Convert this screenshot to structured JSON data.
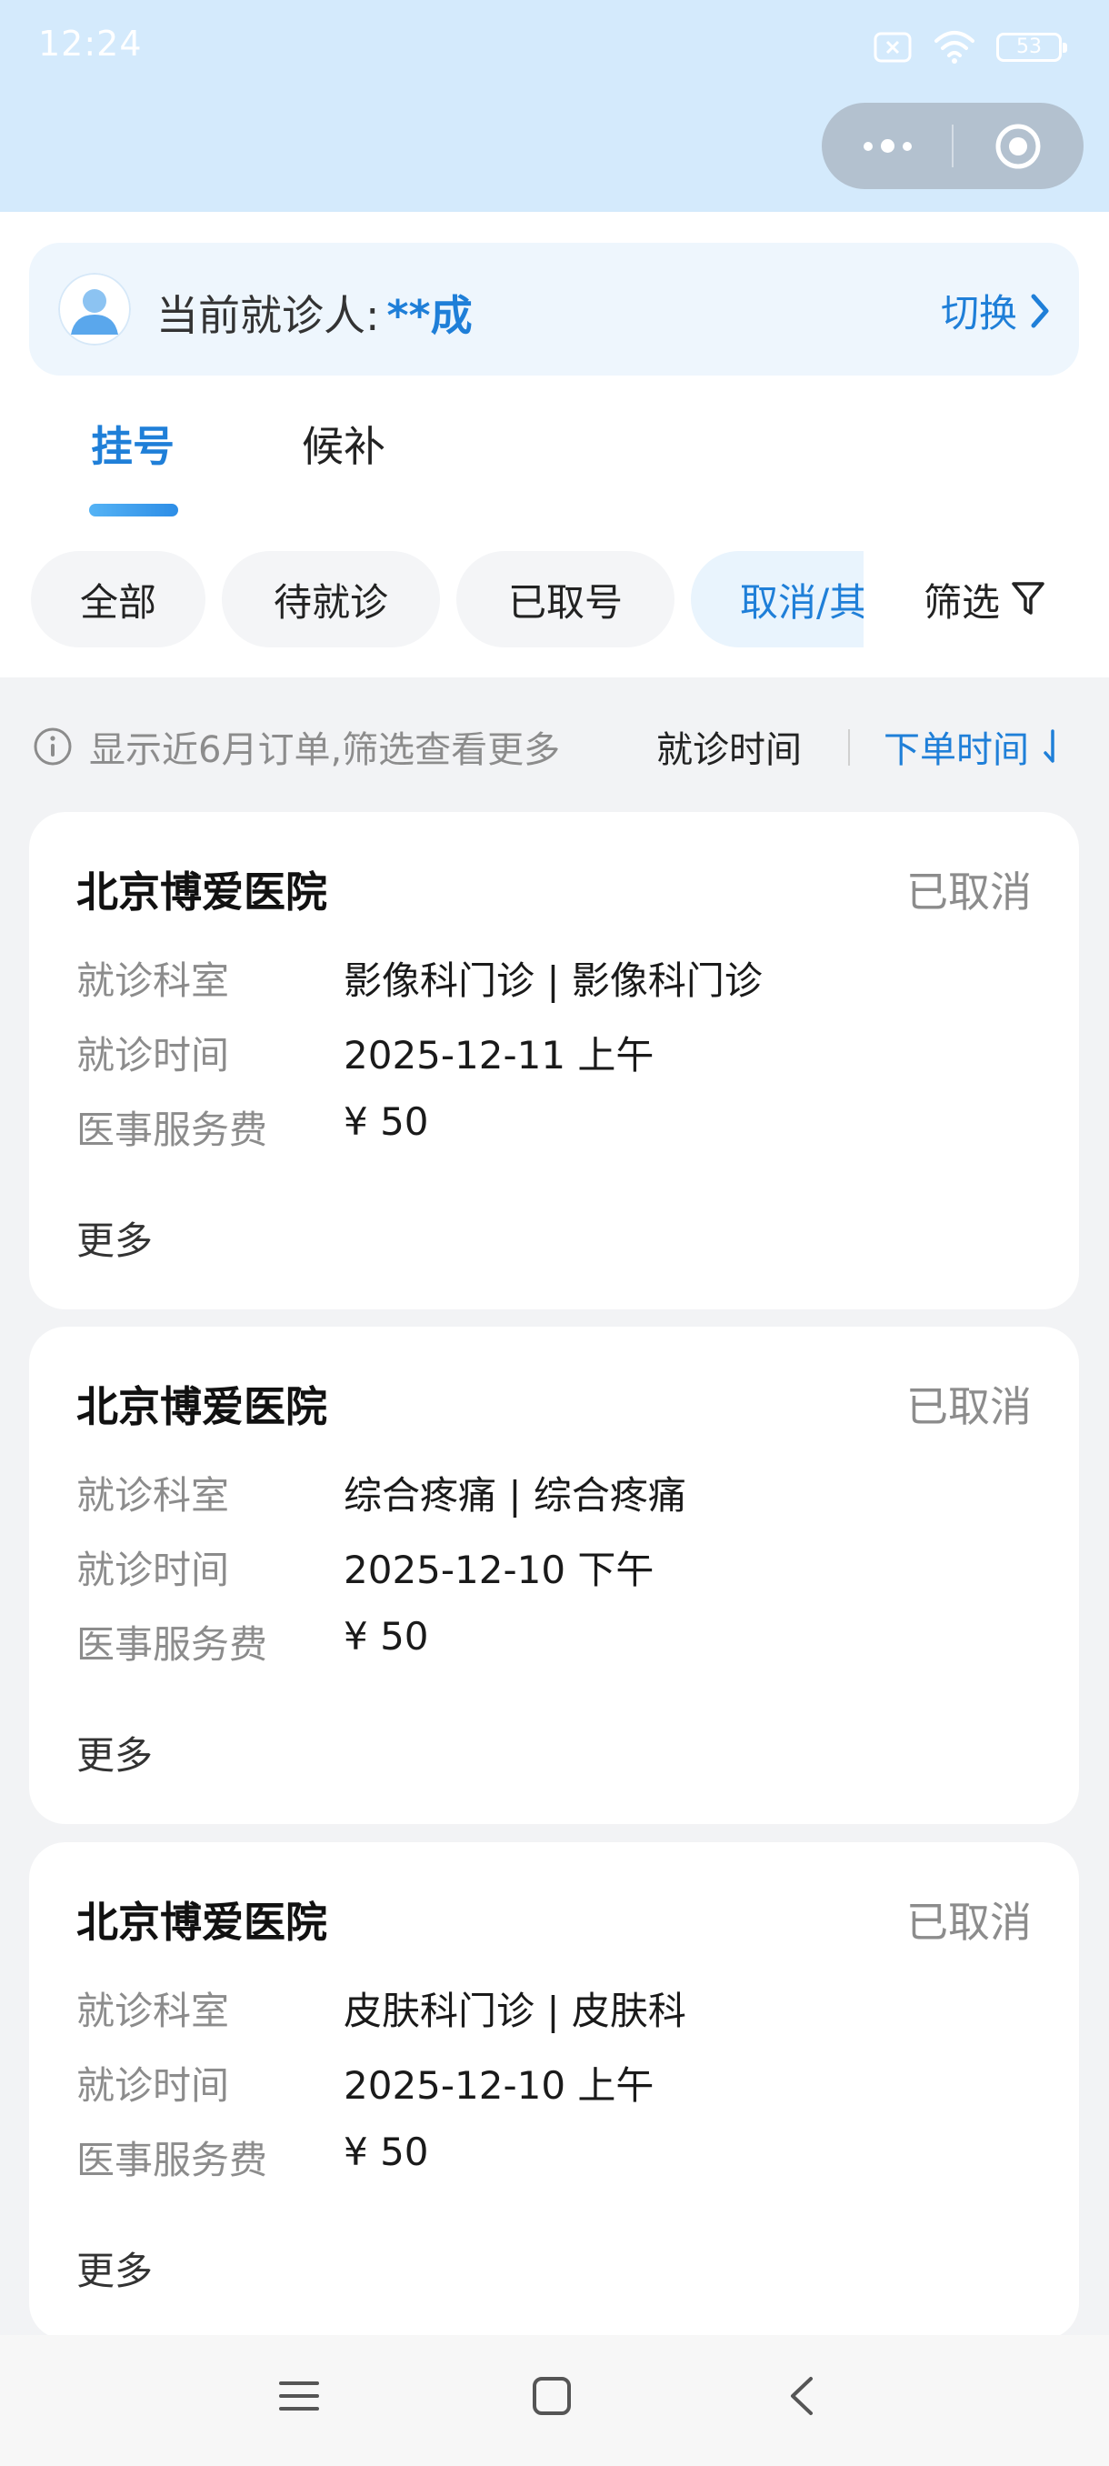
{
  "status_bar": {
    "time": "12:24",
    "battery": "53",
    "icons": [
      "sim-off-icon",
      "wifi-icon",
      "battery-icon"
    ]
  },
  "capsule": {
    "icons": [
      "more-dots-icon",
      "target-circle-icon"
    ]
  },
  "patient": {
    "label": "当前就诊人:",
    "name": "**成",
    "switch_label": "切换"
  },
  "tabs": [
    {
      "label": "挂号",
      "active": true
    },
    {
      "label": "候补",
      "active": false
    }
  ],
  "chips": [
    {
      "label": "全部",
      "active": false
    },
    {
      "label": "待就诊",
      "active": false
    },
    {
      "label": "已取号",
      "active": false
    },
    {
      "label": "取消/其",
      "active": true
    }
  ],
  "filter_label": "筛选",
  "info": {
    "tip": "显示近6月订单,筛选查看更多",
    "sort_visit": "就诊时间",
    "sort_order": "下单时间"
  },
  "orders": [
    {
      "hospital": "北京博爱医院",
      "status": "已取消",
      "dept_label": "就诊科室",
      "dept": "影像科门诊 | 影像科门诊",
      "time_label": "就诊时间",
      "time": "2025-12-11 上午",
      "fee_label": "医事服务费",
      "fee": "¥  50",
      "more": "更多"
    },
    {
      "hospital": "北京博爱医院",
      "status": "已取消",
      "dept_label": "就诊科室",
      "dept": "综合疼痛 | 综合疼痛",
      "time_label": "就诊时间",
      "time": "2025-12-10 下午",
      "fee_label": "医事服务费",
      "fee": "¥  50",
      "more": "更多"
    },
    {
      "hospital": "北京博爱医院",
      "status": "已取消",
      "dept_label": "就诊科室",
      "dept": "皮肤科门诊 | 皮肤科",
      "time_label": "就诊时间",
      "time": "2025-12-10 上午",
      "fee_label": "医事服务费",
      "fee": "¥  50",
      "more": "更多"
    }
  ],
  "nav_bar": {
    "icons": [
      "menu-icon",
      "home-square-icon",
      "back-icon"
    ]
  },
  "colors": {
    "accent": "#1f7fd8",
    "header_bg": "#d4eafc",
    "page_bg": "#f2f3f5",
    "muted_text": "#8c8c8c"
  }
}
